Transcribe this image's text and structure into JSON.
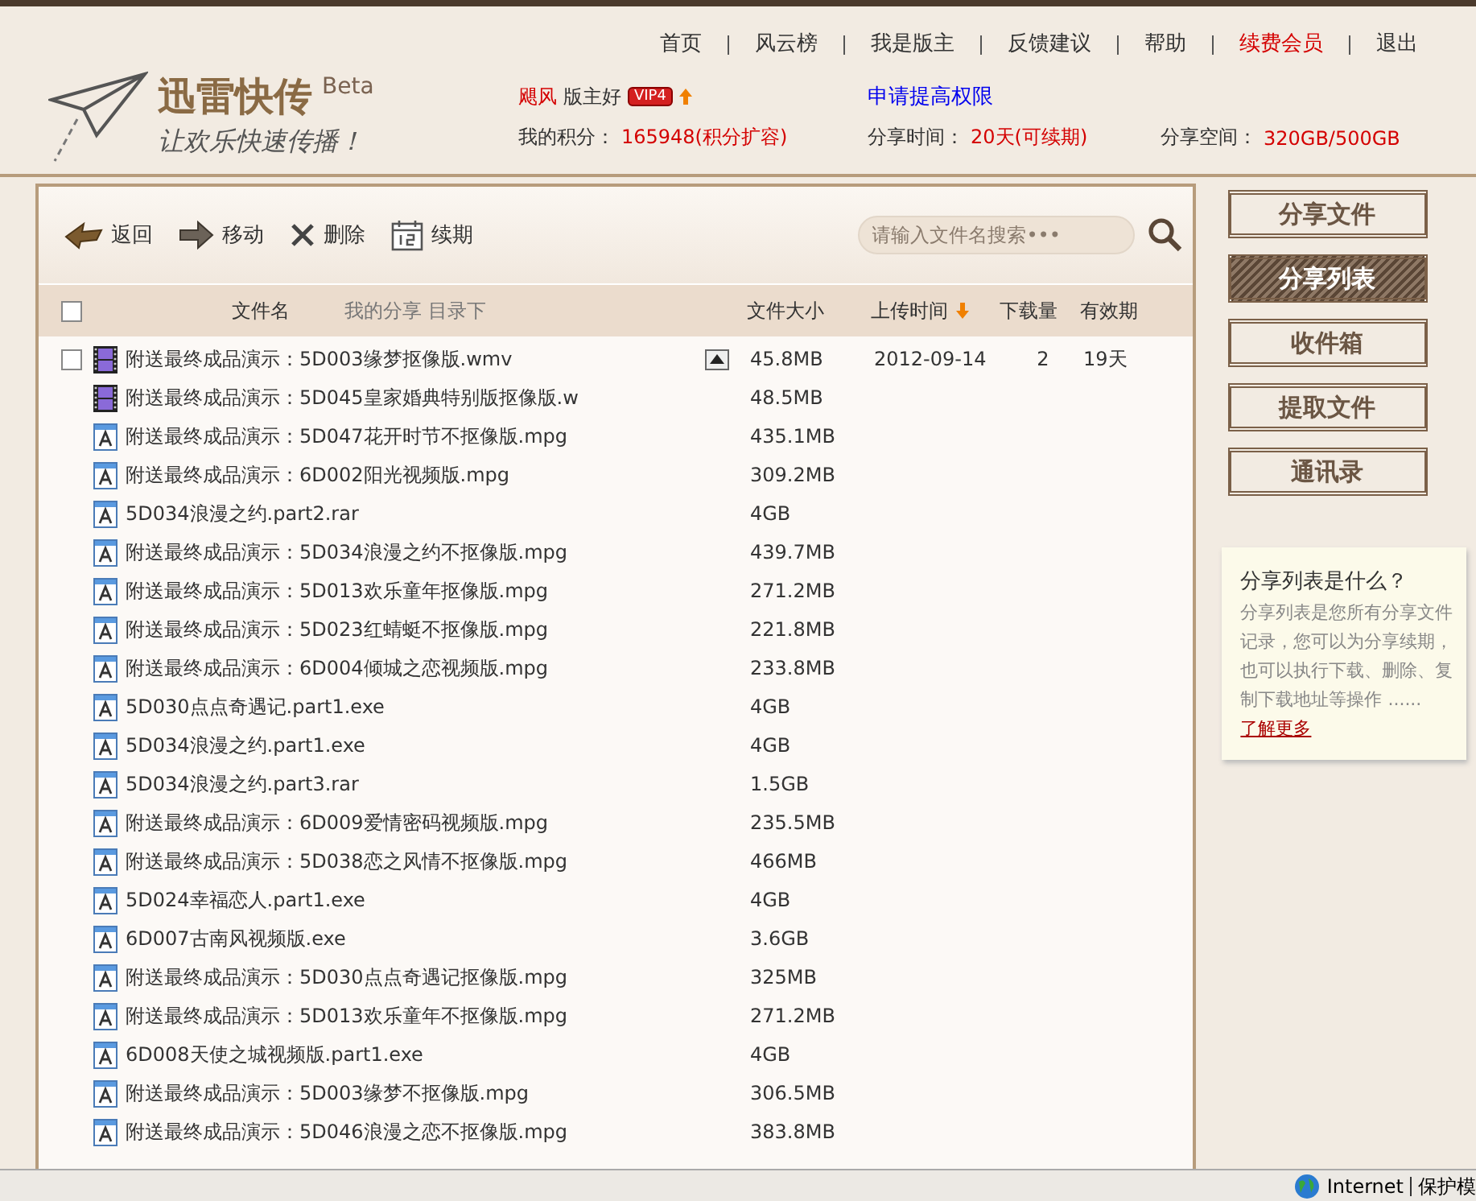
{
  "nav": [
    {
      "label": "首页",
      "highlight": false
    },
    {
      "label": "风云榜",
      "highlight": false
    },
    {
      "label": "我是版主",
      "highlight": false
    },
    {
      "label": "反馈建议",
      "highlight": false
    },
    {
      "label": "帮助",
      "highlight": false
    },
    {
      "label": "续费会员",
      "highlight": true
    },
    {
      "label": "退出",
      "highlight": false
    }
  ],
  "logo": {
    "title": "迅雷快传",
    "badge": "Beta",
    "slogan": "让欢乐快速传播！"
  },
  "user": {
    "name": "飓风",
    "greeting": "版主好",
    "vip": "VIP4",
    "apply_link": "申请提高权限",
    "points_label": "我的积分：",
    "points": "165948(积分扩容)",
    "time_label": "分享时间：",
    "time": "20天(可续期)",
    "space_label": "分享空间：",
    "space": "320GB/500GB"
  },
  "toolbar": {
    "actions": [
      {
        "label": "返回",
        "kind": "back"
      },
      {
        "label": "移动",
        "kind": "move"
      },
      {
        "label": "删除",
        "kind": "delete"
      },
      {
        "label": "续期",
        "kind": "renew"
      }
    ],
    "search": {
      "placeholder": "请输入文件名搜索•••"
    }
  },
  "table": {
    "select_all": {
      "checked": false
    },
    "columns": [
      {
        "label": "文件名",
        "sorted": false
      },
      {
        "label": "文件大小",
        "sorted": false
      },
      {
        "label": "上传时间",
        "sorted": true
      },
      {
        "label": "下载量",
        "sorted": false
      },
      {
        "label": "有效期",
        "sorted": false
      }
    ],
    "path": "我的分享 目录下",
    "rows": [
      {
        "name": "附送最终成品演示：5D003缘梦抠像版.wmv",
        "kind": "video",
        "size": "45.8MB",
        "hovered": true,
        "checked": false,
        "date": "2012-09-14",
        "downloads": "2",
        "expiry": "19天"
      },
      {
        "name": "附送最终成品演示：5D045皇家婚典特别版抠像版.w",
        "kind": "video",
        "size": "48.5MB",
        "hovered": false
      },
      {
        "name": "附送最终成品演示：5D047花开时节不抠像版.mpg",
        "kind": "doc",
        "size": "435.1MB",
        "hovered": false
      },
      {
        "name": "附送最终成品演示：6D002阳光视频版.mpg",
        "kind": "doc",
        "size": "309.2MB",
        "hovered": false
      },
      {
        "name": "5D034浪漫之约.part2.rar",
        "kind": "doc",
        "size": "4GB",
        "hovered": false
      },
      {
        "name": "附送最终成品演示：5D034浪漫之约不抠像版.mpg",
        "kind": "doc",
        "size": "439.7MB",
        "hovered": false
      },
      {
        "name": "附送最终成品演示：5D013欢乐童年抠像版.mpg",
        "kind": "doc",
        "size": "271.2MB",
        "hovered": false
      },
      {
        "name": "附送最终成品演示：5D023红蜻蜓不抠像版.mpg",
        "kind": "doc",
        "size": "221.8MB",
        "hovered": false
      },
      {
        "name": "附送最终成品演示：6D004倾城之恋视频版.mpg",
        "kind": "doc",
        "size": "233.8MB",
        "hovered": false
      },
      {
        "name": "5D030点点奇遇记.part1.exe",
        "kind": "doc",
        "size": "4GB",
        "hovered": false
      },
      {
        "name": "5D034浪漫之约.part1.exe",
        "kind": "doc",
        "size": "4GB",
        "hovered": false
      },
      {
        "name": "5D034浪漫之约.part3.rar",
        "kind": "doc",
        "size": "1.5GB",
        "hovered": false
      },
      {
        "name": "附送最终成品演示：6D009爱情密码视频版.mpg",
        "kind": "doc",
        "size": "235.5MB",
        "hovered": false
      },
      {
        "name": "附送最终成品演示：5D038恋之风情不抠像版.mpg",
        "kind": "doc",
        "size": "466MB",
        "hovered": false
      },
      {
        "name": "5D024幸福恋人.part1.exe",
        "kind": "doc",
        "size": "4GB",
        "hovered": false
      },
      {
        "name": "6D007古南风视频版.exe",
        "kind": "doc",
        "size": "3.6GB",
        "hovered": false
      },
      {
        "name": "附送最终成品演示：5D030点点奇遇记抠像版.mpg",
        "kind": "doc",
        "size": "325MB",
        "hovered": false
      },
      {
        "name": "附送最终成品演示：5D013欢乐童年不抠像版.mpg",
        "kind": "doc",
        "size": "271.2MB",
        "hovered": false
      },
      {
        "name": "6D008天使之城视频版.part1.exe",
        "kind": "doc",
        "size": "4GB",
        "hovered": false
      },
      {
        "name": "附送最终成品演示：5D003缘梦不抠像版.mpg",
        "kind": "doc",
        "size": "306.5MB",
        "hovered": false
      },
      {
        "name": "附送最终成品演示：5D046浪漫之恋不抠像版.mpg",
        "kind": "doc",
        "size": "383.8MB",
        "hovered": false
      }
    ]
  },
  "sidebar": {
    "items": [
      {
        "label": "分享文件",
        "selected": false
      },
      {
        "label": "分享列表",
        "selected": true
      },
      {
        "label": "收件箱",
        "selected": false
      },
      {
        "label": "提取文件",
        "selected": false
      },
      {
        "label": "通讯录",
        "selected": false
      }
    ]
  },
  "info": {
    "title": "分享列表是什么？",
    "text": "分享列表是您所有分享文件记录，您可以为分享续期，也可以执行下载、删除、复制下载地址等操作 ......",
    "link": "了解更多"
  },
  "status_bar": {
    "zone": "Internet",
    "mode": "保护模"
  }
}
